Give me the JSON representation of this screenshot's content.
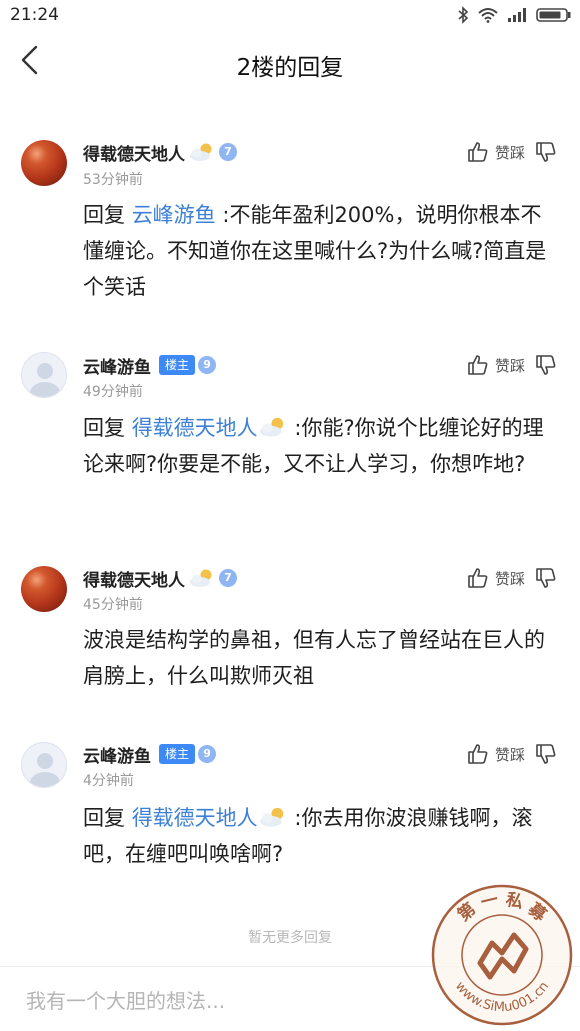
{
  "status_bar": {
    "time": "21:24"
  },
  "nav": {
    "title": "2楼的回复"
  },
  "comments": [
    {
      "username": "得载德天地人",
      "level": "7",
      "time": "53分钟前",
      "like_label": "赞踩",
      "reply_prefix": "回复",
      "mention": "云峰游鱼",
      "text": ":不能年盈利200%，说明你根本不懂缠论。不知道你在这里喊什么?为什么喊?简直是个笑话"
    },
    {
      "username": "云峰游鱼",
      "owner_badge": "楼主",
      "level": "9",
      "time": "49分钟前",
      "like_label": "赞踩",
      "reply_prefix": "回复",
      "mention": "得载德天地人",
      "text": ":你能?你说个比缠论好的理论来啊?你要是不能，又不让人学习，你想咋地?"
    },
    {
      "username": "得载德天地人",
      "level": "7",
      "time": "45分钟前",
      "like_label": "赞踩",
      "text": "波浪是结构学的鼻祖，但有人忘了曾经站在巨人的肩膀上，什么叫欺师灭祖"
    },
    {
      "username": "云峰游鱼",
      "owner_badge": "楼主",
      "level": "9",
      "time": "4分钟前",
      "like_label": "赞踩",
      "reply_prefix": "回复",
      "mention": "得载德天地人",
      "text": ":你去用你波浪赚钱啊，滚吧，在缠吧叫唤啥啊?"
    }
  ],
  "footer_note": "暂无更多回复",
  "input": {
    "placeholder": "我有一个大胆的想法..."
  },
  "watermark": {
    "top_text": "第 一 私 募",
    "bottom_text": "www.SiMu001.cn"
  },
  "colors": {
    "mention": "#3c80d8",
    "owner_badge": "#3d8af7",
    "level_badge": "#8fb6f2",
    "watermark": "#a0522d"
  }
}
